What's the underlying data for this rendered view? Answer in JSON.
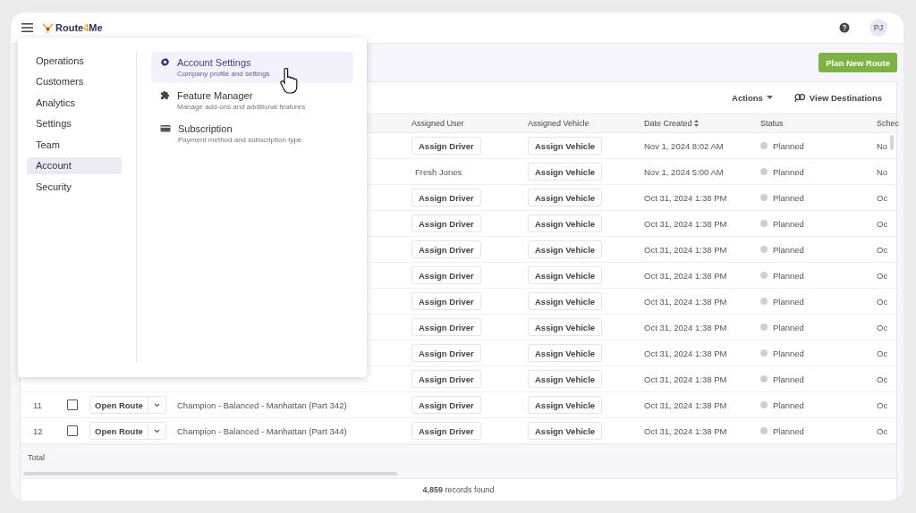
{
  "header": {
    "logo": {
      "start": "Route",
      "accent": "4",
      "end": "Me"
    },
    "avatar": "PJ"
  },
  "menu": {
    "sections": [
      {
        "label": "Operations",
        "selected": false
      },
      {
        "label": "Customers",
        "selected": false
      },
      {
        "label": "Analytics",
        "selected": false
      },
      {
        "label": "Settings",
        "selected": false
      },
      {
        "label": "Team",
        "selected": false
      },
      {
        "label": "Account",
        "selected": true
      },
      {
        "label": "Security",
        "selected": false
      }
    ],
    "items": [
      {
        "kind": "gear",
        "title": "Account Settings",
        "description": "Company profile and settings",
        "selected": true
      },
      {
        "kind": "puzzle",
        "title": "Feature Manager",
        "description": "Manage add-ons and additional features",
        "selected": false
      },
      {
        "kind": "card",
        "title": "Subscription",
        "description": "Payment method and subscription type",
        "selected": false
      }
    ]
  },
  "plan_button": "Plan New Route",
  "toolbar": {
    "actions": "Actions",
    "view": "View Destinations"
  },
  "table": {
    "columns": [
      "Assigned User",
      "Assigned Vehicle",
      "Date Created",
      "Status",
      "Schec"
    ],
    "rows": [
      {
        "user": {
          "kind": "button",
          "text": "Assign Driver"
        },
        "vehicle": "Assign Vehicle",
        "date": "Nov 1, 2024 8:02 AM",
        "status": "Planned",
        "schedule": "No"
      },
      {
        "user": {
          "kind": "text",
          "text": "Fresh Jones"
        },
        "vehicle": "Assign Vehicle",
        "date": "Nov 1, 2024 5:00 AM",
        "status": "Planned",
        "schedule": "No"
      },
      {
        "user": {
          "kind": "button",
          "text": "Assign Driver"
        },
        "vehicle": "Assign Vehicle",
        "date": "Oct 31, 2024 1:38 PM",
        "status": "Planned",
        "schedule": "Oc"
      },
      {
        "user": {
          "kind": "button",
          "text": "Assign Driver"
        },
        "vehicle": "Assign Vehicle",
        "date": "Oct 31, 2024 1:38 PM",
        "status": "Planned",
        "schedule": "Oc"
      },
      {
        "user": {
          "kind": "button",
          "text": "Assign Driver"
        },
        "vehicle": "Assign Vehicle",
        "date": "Oct 31, 2024 1:38 PM",
        "status": "Planned",
        "schedule": "Oc"
      },
      {
        "user": {
          "kind": "button",
          "text": "Assign Driver"
        },
        "vehicle": "Assign Vehicle",
        "date": "Oct 31, 2024 1:38 PM",
        "status": "Planned",
        "schedule": "Oc"
      },
      {
        "user": {
          "kind": "button",
          "text": "Assign Driver"
        },
        "vehicle": "Assign Vehicle",
        "date": "Oct 31, 2024 1:38 PM",
        "status": "Planned",
        "schedule": "Oc"
      },
      {
        "user": {
          "kind": "button",
          "text": "Assign Driver"
        },
        "vehicle": "Assign Vehicle",
        "date": "Oct 31, 2024 1:38 PM",
        "status": "Planned",
        "schedule": "Oc"
      },
      {
        "user": {
          "kind": "button",
          "text": "Assign Driver"
        },
        "vehicle": "Assign Vehicle",
        "date": "Oct 31, 2024 1:38 PM",
        "status": "Planned",
        "schedule": "Oc"
      },
      {
        "user": {
          "kind": "button",
          "text": "Assign Driver"
        },
        "vehicle": "Assign Vehicle",
        "date": "Oct 31, 2024 1:38 PM",
        "status": "Planned",
        "schedule": "Oc"
      },
      {
        "index": "11",
        "checked": false,
        "open": "Open Route",
        "name": "Champion - Balanced - Manhattan (Part 342)",
        "user": {
          "kind": "button",
          "text": "Assign Driver"
        },
        "vehicle": "Assign Vehicle",
        "date": "Oct 31, 2024 1:38 PM",
        "status": "Planned",
        "schedule": "Oc"
      },
      {
        "index": "12",
        "checked": false,
        "open": "Open Route",
        "name": "Champion - Balanced - Manhattan (Part 344)",
        "user": {
          "kind": "button",
          "text": "Assign Driver"
        },
        "vehicle": "Assign Vehicle",
        "date": "Oct 31, 2024 1:38 PM",
        "status": "Planned",
        "schedule": "Oc"
      }
    ],
    "total": "Total"
  },
  "footer": "**4,859** records found"
}
